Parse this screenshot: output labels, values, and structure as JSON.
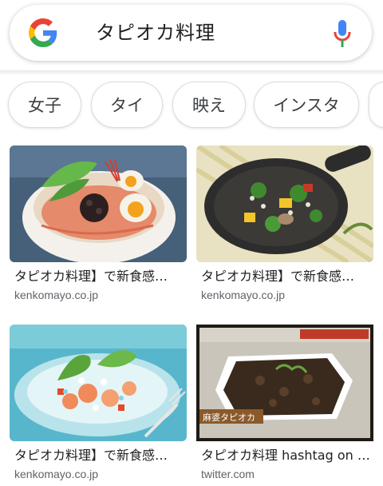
{
  "search": {
    "query": "タピオカ料理",
    "logo_icon": "google-g-logo",
    "mic_icon": "microphone-icon"
  },
  "chips": [
    {
      "label": "女子"
    },
    {
      "label": "タイ"
    },
    {
      "label": "映え"
    },
    {
      "label": "インスタ"
    }
  ],
  "results": [
    {
      "title": "タピオカ料理】で新食感…",
      "source": "kenkomayo.co.jp",
      "image": "tapioca-ramen-bowl"
    },
    {
      "title": "タピオカ料理】で新食感…",
      "source": "kenkomayo.co.jp",
      "image": "tapioca-skillet-vegetables"
    },
    {
      "title": "タピオカ料理】で新食感…",
      "source": "kenkomayo.co.jp",
      "image": "tapioca-shrimp-salad"
    },
    {
      "title": "タピオカ料理 hashtag on …",
      "source": "twitter.com",
      "image": "mapo-tapioca-tv-screenshot",
      "overlay_caption": "麻婆タピオカ"
    }
  ],
  "colors": {
    "google_blue": "#4285F4",
    "google_red": "#EA4335",
    "google_yellow": "#FBBC05",
    "google_green": "#34A853"
  }
}
